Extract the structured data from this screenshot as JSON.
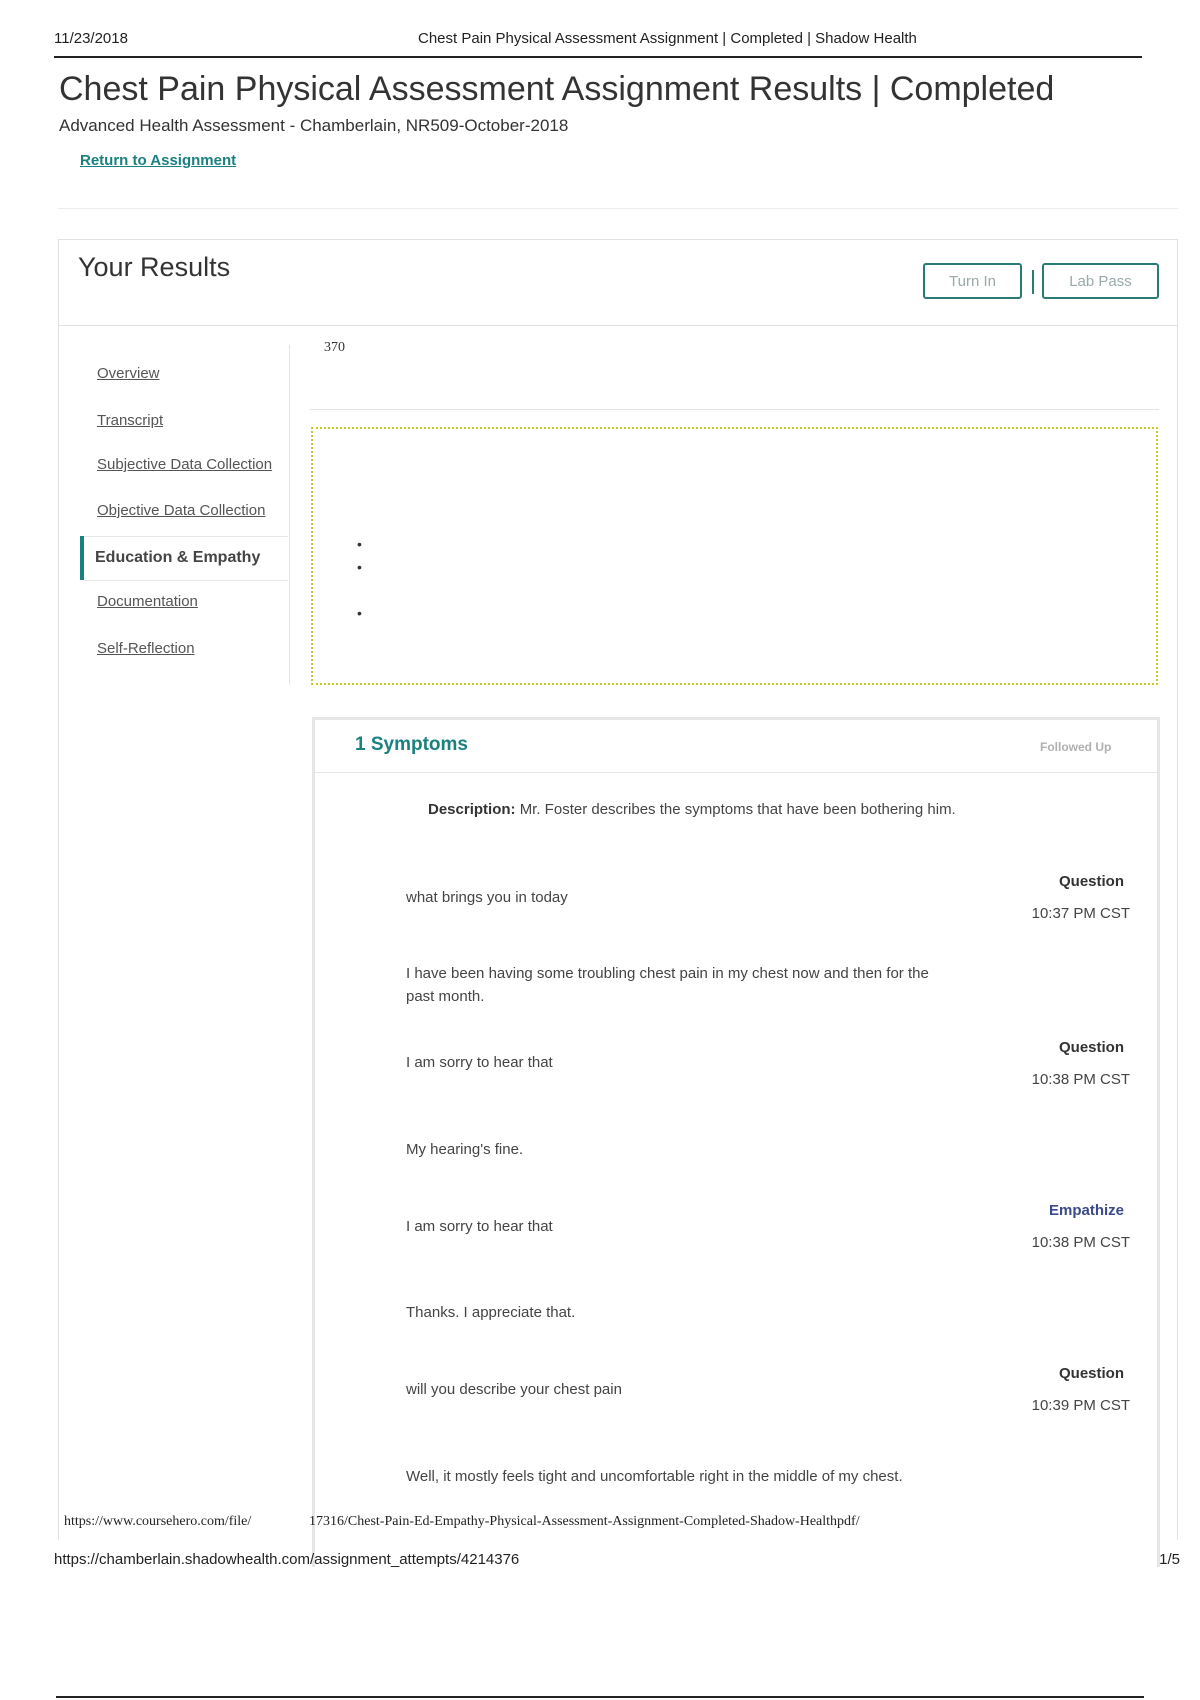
{
  "print_header": {
    "date": "11/23/2018",
    "page_title": "Chest Pain Physical Assessment Assignment | Completed | Shadow Health"
  },
  "page": {
    "title": "Chest Pain Physical Assessment Assignment Results | Completed",
    "subtitle": "Advanced Health Assessment - Chamberlain, NR509-October-2018",
    "return_link": "Return to Assignment"
  },
  "results": {
    "heading": "Your Results",
    "turn_in_label": "Turn In",
    "lab_pass_label": "Lab Pass",
    "score": "370"
  },
  "sidebar": {
    "items": [
      {
        "label": "Overview"
      },
      {
        "label": "Transcript"
      },
      {
        "label": "Subjective Data Collection"
      },
      {
        "label": "Objective Data Collection"
      },
      {
        "label": "Education & Empathy",
        "active": true
      },
      {
        "label": "Documentation"
      },
      {
        "label": "Self-Reflection"
      }
    ]
  },
  "bullets": [
    "•",
    "•",
    "•"
  ],
  "section": {
    "title": "1 Symptoms",
    "status": "Followed Up",
    "description_label": "Description:",
    "description_text": "Mr. Foster describes the symptoms that have been bothering him."
  },
  "transcript": [
    {
      "text": "what brings you in today",
      "tag": "Question",
      "time": "10:37 PM CST"
    },
    {
      "text": "I have been having some troubling chest pain in my chest now and then for the past month."
    },
    {
      "text": "I am sorry to hear that",
      "tag": "Question",
      "time": "10:38 PM CST"
    },
    {
      "text": "My hearing's fine."
    },
    {
      "text": "I am sorry to hear that",
      "tag": "Empathize",
      "time": "10:38 PM CST"
    },
    {
      "text": "Thanks. I appreciate that."
    },
    {
      "text": "will you describe your chest pain",
      "tag": "Question",
      "time": "10:39 PM CST"
    },
    {
      "text": "Well, it mostly feels tight and uncomfortable right in the middle of my chest."
    }
  ],
  "watermark": {
    "left": "https://www.coursehero.com/file/",
    "right": "17316/Chest-Pain-Ed-Empathy-Physical-Assessment-Assignment-Completed-Shadow-Healthpdf/"
  },
  "print_footer": {
    "url": "https://chamberlain.shadowhealth.com/assignment_attempts/4214376",
    "page_number": "1/5"
  },
  "colors": {
    "accent_teal": "#1a8080",
    "button_border": "#2a7a77",
    "empathize": "#3a4a8a",
    "dotted_border": "#c8c820"
  }
}
